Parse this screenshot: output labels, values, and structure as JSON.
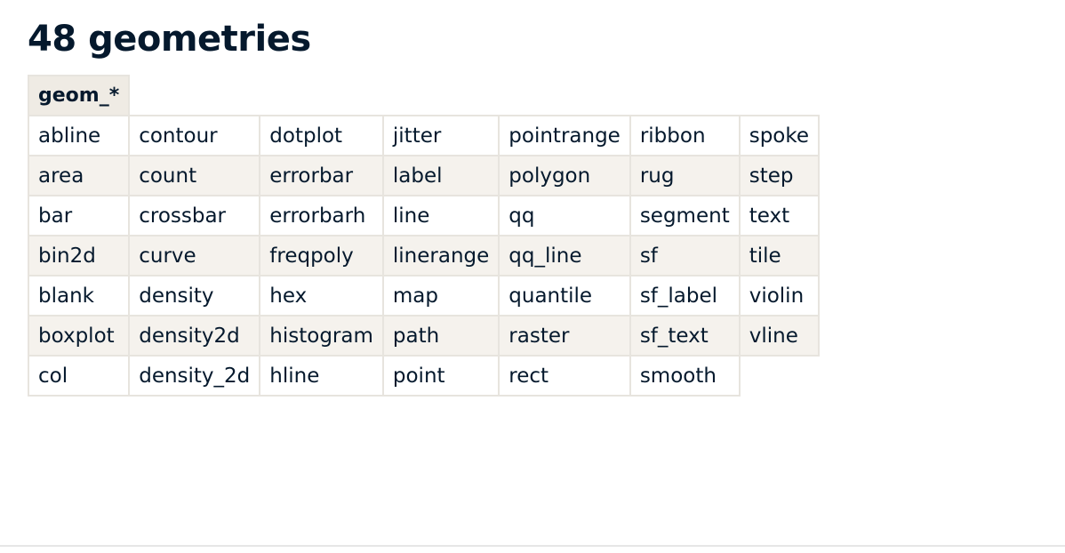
{
  "page_title": "48 geometries",
  "table": {
    "header": "geom_*",
    "rows": [
      [
        "abline",
        "contour",
        "dotplot",
        "jitter",
        "pointrange",
        "ribbon",
        "spoke"
      ],
      [
        "area",
        "count",
        "errorbar",
        "label",
        "polygon",
        "rug",
        "step"
      ],
      [
        "bar",
        "crossbar",
        "errorbarh",
        "line",
        "qq",
        "segment",
        "text"
      ],
      [
        "bin2d",
        "curve",
        "freqpoly",
        "linerange",
        "qq_line",
        "sf",
        "tile"
      ],
      [
        "blank",
        "density",
        "hex",
        "map",
        "quantile",
        "sf_label",
        "violin"
      ],
      [
        "boxplot",
        "density2d",
        "histogram",
        "path",
        "raster",
        "sf_text",
        "vline"
      ],
      [
        "col",
        "density_2d",
        "hline",
        "point",
        "rect",
        "smooth",
        ""
      ]
    ]
  }
}
